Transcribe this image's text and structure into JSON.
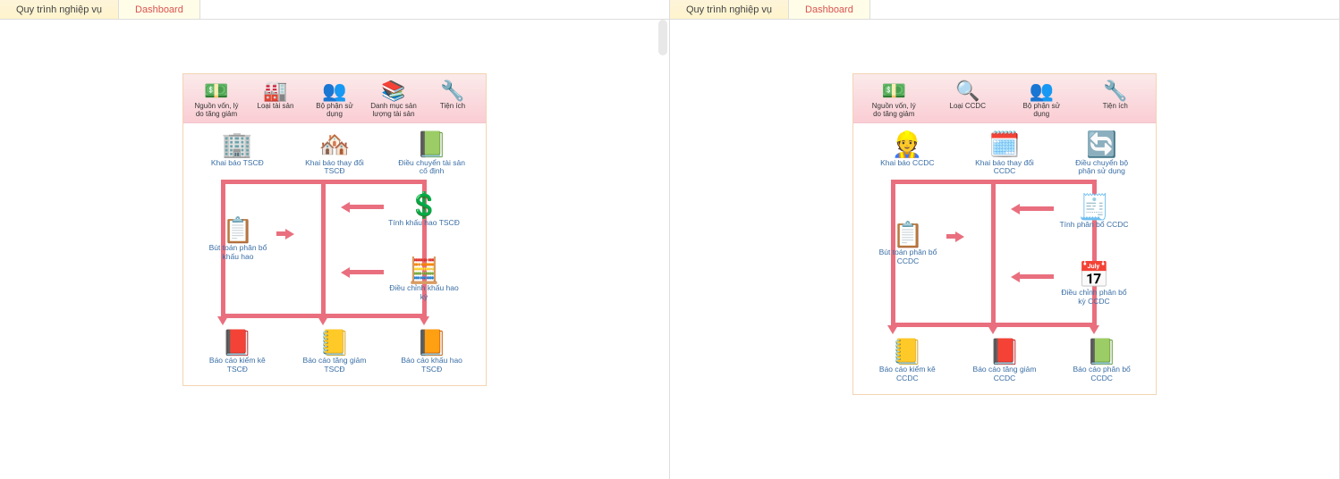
{
  "tabs": {
    "active": "Quy trình nghiệp vụ",
    "inactive": "Dashboard"
  },
  "left": {
    "toolbar": [
      {
        "label": "Nguồn vốn,\nlý do tăng giảm",
        "icon": "funding-icon",
        "glyph": "💵"
      },
      {
        "label": "Loại tài sản",
        "icon": "asset-type-icon",
        "glyph": "🏭"
      },
      {
        "label": "Bộ phận sử dụng",
        "icon": "department-icon",
        "glyph": "👥"
      },
      {
        "label": "Danh mục\nsản lượng tài sản",
        "icon": "catalog-icon",
        "glyph": "📚"
      },
      {
        "label": "Tiện ích",
        "icon": "utility-icon",
        "glyph": "🔧"
      }
    ],
    "row1": [
      {
        "label": "Khai báo TSCĐ",
        "icon": "declare-asset-icon",
        "glyph": "🏢"
      },
      {
        "label": "Khai báo\nthay đổi TSCĐ",
        "icon": "change-asset-icon",
        "glyph": "🏘️"
      },
      {
        "label": "Điều chuyển\ntài sản cố định",
        "icon": "transfer-asset-icon",
        "glyph": "📗"
      }
    ],
    "mid_left": {
      "label": "Bút toán phân bổ\nkhấu hao",
      "icon": "allocation-entry-icon",
      "glyph": "📋"
    },
    "mid_right1": {
      "label": "Tính khấu hao\nTSCĐ",
      "icon": "calc-depreciation-icon",
      "glyph": "💲"
    },
    "mid_right2": {
      "label": "Điều chỉnh\nkhấu hao kỳ",
      "icon": "adjust-depreciation-icon",
      "glyph": "🧮"
    },
    "row3": [
      {
        "label": "Báo cáo kiểm kê\nTSCĐ",
        "icon": "inventory-report-icon",
        "glyph": "📕"
      },
      {
        "label": "Báo cáo tăng giảm\nTSCĐ",
        "icon": "change-report-icon",
        "glyph": "📒"
      },
      {
        "label": "Báo cáo khấu hao\nTSCĐ",
        "icon": "depreciation-report-icon",
        "glyph": "📙"
      }
    ]
  },
  "right": {
    "toolbar": [
      {
        "label": "Nguồn vốn,\nlý do tăng giảm",
        "icon": "funding-icon",
        "glyph": "💵"
      },
      {
        "label": "Loại CCDC",
        "icon": "tool-type-icon",
        "glyph": "🔍"
      },
      {
        "label": "Bộ phận sử dụng",
        "icon": "department-icon",
        "glyph": "👥"
      },
      {
        "label": "Tiện ích",
        "icon": "utility-icon",
        "glyph": "🔧"
      }
    ],
    "row1": [
      {
        "label": "Khai báo CCDC",
        "icon": "declare-tool-icon",
        "glyph": "👷"
      },
      {
        "label": "Khai báo\nthay đổi CCDC",
        "icon": "change-tool-icon",
        "glyph": "🗓️"
      },
      {
        "label": "Điều chuyển\nbộ phận sử dụng",
        "icon": "transfer-dept-icon",
        "glyph": "🔄"
      }
    ],
    "mid_left": {
      "label": "Bút toán phân bổ\nCCDC",
      "icon": "allocation-entry-icon",
      "glyph": "📋"
    },
    "mid_right1": {
      "label": "Tính phân bổ\nCCDC",
      "icon": "calc-allocation-icon",
      "glyph": "🧾"
    },
    "mid_right2": {
      "label": "Điều chỉnh phân bổ\nkỳ CCDC",
      "icon": "adjust-allocation-icon",
      "glyph": "📅"
    },
    "row3": [
      {
        "label": "Báo cáo kiểm kê\nCCDC",
        "icon": "inventory-report-icon",
        "glyph": "📒"
      },
      {
        "label": "Báo cáo tăng giảm\nCCDC",
        "icon": "change-report-icon",
        "glyph": "📕"
      },
      {
        "label": "Báo cáo phân bổ\nCCDC",
        "icon": "allocation-report-icon",
        "glyph": "📗"
      }
    ]
  }
}
